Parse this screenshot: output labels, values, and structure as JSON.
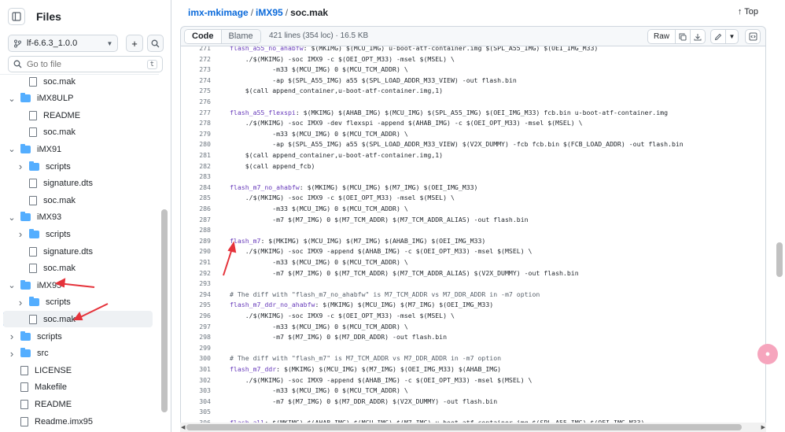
{
  "sidebar": {
    "title": "Files",
    "branch": "lf-6.6.3_1.0.0",
    "goto_placeholder": "Go to file",
    "goto_shortcut": "t",
    "tree": [
      {
        "label": "soc.mak",
        "type": "file",
        "indent": 2
      },
      {
        "label": "iMX8ULP",
        "type": "folder",
        "indent": 1,
        "expanded": true
      },
      {
        "label": "README",
        "type": "file",
        "indent": 2
      },
      {
        "label": "soc.mak",
        "type": "file",
        "indent": 2
      },
      {
        "label": "iMX91",
        "type": "folder",
        "indent": 1,
        "expanded": true
      },
      {
        "label": "scripts",
        "type": "folder",
        "indent": 2,
        "expanded": false
      },
      {
        "label": "signature.dts",
        "type": "file",
        "indent": 2
      },
      {
        "label": "soc.mak",
        "type": "file",
        "indent": 2
      },
      {
        "label": "iMX93",
        "type": "folder",
        "indent": 1,
        "expanded": true
      },
      {
        "label": "scripts",
        "type": "folder",
        "indent": 2,
        "expanded": false
      },
      {
        "label": "signature.dts",
        "type": "file",
        "indent": 2
      },
      {
        "label": "soc.mak",
        "type": "file",
        "indent": 2
      },
      {
        "label": "iMX95",
        "type": "folder",
        "indent": 1,
        "expanded": true
      },
      {
        "label": "scripts",
        "type": "folder",
        "indent": 2,
        "expanded": false
      },
      {
        "label": "soc.mak",
        "type": "file",
        "indent": 2,
        "selected": true
      },
      {
        "label": "scripts",
        "type": "folder",
        "indent": 1,
        "expanded": false
      },
      {
        "label": "src",
        "type": "folder",
        "indent": 1,
        "expanded": false
      },
      {
        "label": "LICENSE",
        "type": "file",
        "indent": 1
      },
      {
        "label": "Makefile",
        "type": "file",
        "indent": 1
      },
      {
        "label": "README",
        "type": "file",
        "indent": 1
      },
      {
        "label": "Readme.imx95",
        "type": "file",
        "indent": 1
      }
    ]
  },
  "breadcrumb": {
    "repo": "imx-mkimage",
    "folder": "iMX95",
    "file": "soc.mak",
    "top_label": "Top"
  },
  "filebar": {
    "code_tab": "Code",
    "blame_tab": "Blame",
    "info": "421 lines (354 loc) · 16.5 KB",
    "raw_label": "Raw"
  },
  "code_lines": [
    {
      "n": "271",
      "t": "flash_a55_no_ahabfw: $(MKIMG) $(MCU_IMG) u-boot-atf-container.img $(SPL_A55_IMG) $(OEI_IMG_M33)",
      "k": "tgt"
    },
    {
      "n": "272",
      "t": "\t./$(MKIMG) -soc IMX9 -c $(OEI_OPT_M33) -msel $(MSEL) \\",
      "k": ""
    },
    {
      "n": "273",
      "t": "\t\t   -m33 $(MCU_IMG) 0 $(MCU_TCM_ADDR) \\",
      "k": ""
    },
    {
      "n": "274",
      "t": "\t\t   -ap $(SPL_A55_IMG) a55 $(SPL_LOAD_ADDR_M33_VIEW) -out flash.bin",
      "k": ""
    },
    {
      "n": "275",
      "t": "\t$(call append_container,u-boot-atf-container.img,1)",
      "k": ""
    },
    {
      "n": "276",
      "t": "",
      "k": ""
    },
    {
      "n": "277",
      "t": "flash_a55_flexspi: $(MKIMG) $(AHAB_IMG) $(MCU_IMG) $(SPL_A55_IMG) $(OEI_IMG_M33) fcb.bin u-boot-atf-container.img",
      "k": "tgt"
    },
    {
      "n": "278",
      "t": "\t./$(MKIMG) -soc IMX9 -dev flexspi -append $(AHAB_IMG) -c $(OEI_OPT_M33) -msel $(MSEL) \\",
      "k": ""
    },
    {
      "n": "279",
      "t": "\t\t   -m33 $(MCU_IMG) 0 $(MCU_TCM_ADDR) \\",
      "k": ""
    },
    {
      "n": "280",
      "t": "\t\t   -ap $(SPL_A55_IMG) a55 $(SPL_LOAD_ADDR_M33_VIEW) $(V2X_DUMMY) -fcb fcb.bin $(FCB_LOAD_ADDR) -out flash.bin",
      "k": ""
    },
    {
      "n": "281",
      "t": "\t$(call append_container,u-boot-atf-container.img,1)",
      "k": ""
    },
    {
      "n": "282",
      "t": "\t$(call append_fcb)",
      "k": ""
    },
    {
      "n": "283",
      "t": "",
      "k": ""
    },
    {
      "n": "284",
      "t": "flash_m7_no_ahabfw: $(MKIMG) $(MCU_IMG) $(M7_IMG) $(OEI_IMG_M33)",
      "k": "tgt"
    },
    {
      "n": "285",
      "t": "\t./$(MKIMG) -soc IMX9 -c $(OEI_OPT_M33) -msel $(MSEL) \\",
      "k": ""
    },
    {
      "n": "286",
      "t": "\t\t   -m33 $(MCU_IMG) 0 $(MCU_TCM_ADDR) \\",
      "k": ""
    },
    {
      "n": "287",
      "t": "\t\t   -m7 $(M7_IMG) 0 $(M7_TCM_ADDR) $(M7_TCM_ADDR_ALIAS) -out flash.bin",
      "k": ""
    },
    {
      "n": "288",
      "t": "",
      "k": ""
    },
    {
      "n": "289",
      "t": "flash_m7: $(MKIMG) $(MCU_IMG) $(M7_IMG) $(AHAB_IMG) $(OEI_IMG_M33)",
      "k": "tgt"
    },
    {
      "n": "290",
      "t": "\t./$(MKIMG) -soc IMX9 -append $(AHAB_IMG) -c $(OEI_OPT_M33) -msel $(MSEL) \\",
      "k": ""
    },
    {
      "n": "291",
      "t": "\t\t   -m33 $(MCU_IMG) 0 $(MCU_TCM_ADDR) \\",
      "k": ""
    },
    {
      "n": "292",
      "t": "\t\t   -m7 $(M7_IMG) 0 $(M7_TCM_ADDR) $(M7_TCM_ADDR_ALIAS) $(V2X_DUMMY) -out flash.bin",
      "k": ""
    },
    {
      "n": "293",
      "t": "",
      "k": ""
    },
    {
      "n": "294",
      "t": "# The diff with \"flash_m7_no_ahabfw\" is M7_TCM_ADDR vs M7_DDR_ADDR in -m7 option",
      "k": "cmt"
    },
    {
      "n": "295",
      "t": "flash_m7_ddr_no_ahabfw: $(MKIMG) $(MCU_IMG) $(M7_IMG) $(OEI_IMG_M33)",
      "k": "tgt"
    },
    {
      "n": "296",
      "t": "\t./$(MKIMG) -soc IMX9 -c $(OEI_OPT_M33) -msel $(MSEL) \\",
      "k": ""
    },
    {
      "n": "297",
      "t": "\t\t   -m33 $(MCU_IMG) 0 $(MCU_TCM_ADDR) \\",
      "k": ""
    },
    {
      "n": "298",
      "t": "\t\t   -m7 $(M7_IMG) 0 $(M7_DDR_ADDR) -out flash.bin",
      "k": ""
    },
    {
      "n": "299",
      "t": "",
      "k": ""
    },
    {
      "n": "300",
      "t": "# The diff with \"flash_m7\" is M7_TCM_ADDR vs M7_DDR_ADDR in -m7 option",
      "k": "cmt"
    },
    {
      "n": "301",
      "t": "flash_m7_ddr: $(MKIMG) $(MCU_IMG) $(M7_IMG) $(OEI_IMG_M33) $(AHAB_IMG)",
      "k": "tgt"
    },
    {
      "n": "302",
      "t": "\t./$(MKIMG) -soc IMX9 -append $(AHAB_IMG) -c $(OEI_OPT_M33) -msel $(MSEL) \\",
      "k": ""
    },
    {
      "n": "303",
      "t": "\t\t   -m33 $(MCU_IMG) 0 $(MCU_TCM_ADDR) \\",
      "k": ""
    },
    {
      "n": "304",
      "t": "\t\t   -m7 $(M7_IMG) 0 $(M7_DDR_ADDR) $(V2X_DUMMY) -out flash.bin",
      "k": ""
    },
    {
      "n": "305",
      "t": "",
      "k": ""
    },
    {
      "n": "306",
      "t": "flash_all: $(MKIMG) $(AHAB_IMG) $(MCU_IMG) $(M7_IMG) u-boot-atf-container.img $(SPL_A55_IMG) $(OEI_IMG_M33)",
      "k": "tgt"
    }
  ],
  "colors": {
    "accent": "#0969da",
    "annotation_arrow": "#e5333b",
    "target_text": "#6639ba"
  }
}
